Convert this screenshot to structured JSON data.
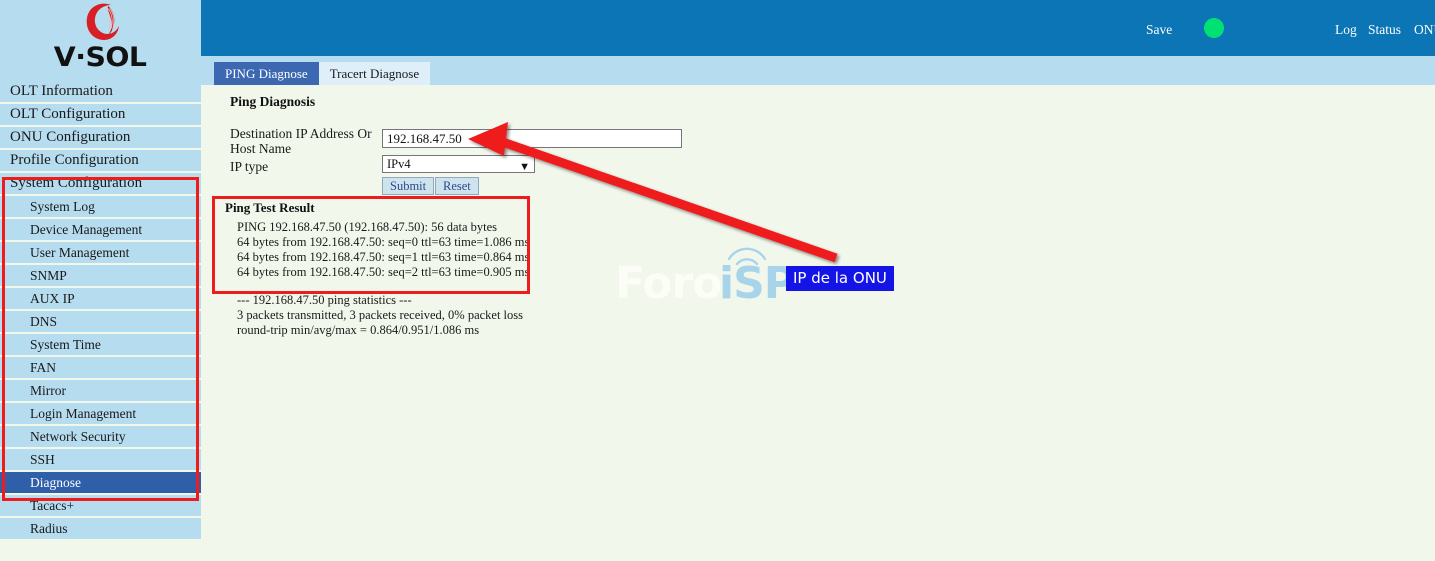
{
  "brand": {
    "logo_text": "V·SOL",
    "logo_icon": "vsol-crescent-logo"
  },
  "header": {
    "save_label": "Save",
    "status_dot": "status-indicator-green",
    "status_dot_color": "#00e173",
    "log_label": "Log",
    "status_label": "Status",
    "onu_label": "ONU",
    "background_color": "#0b75b5"
  },
  "sidebar": {
    "items": [
      {
        "label": "OLT Information",
        "level": "top",
        "selected": false
      },
      {
        "label": "OLT Configuration",
        "level": "top",
        "selected": false
      },
      {
        "label": "ONU Configuration",
        "level": "top",
        "selected": false
      },
      {
        "label": "Profile Configuration",
        "level": "top",
        "selected": false
      },
      {
        "label": "System Configuration",
        "level": "top",
        "selected": false
      },
      {
        "label": "System Log",
        "level": "sub",
        "selected": false
      },
      {
        "label": "Device Management",
        "level": "sub",
        "selected": false
      },
      {
        "label": "User Management",
        "level": "sub",
        "selected": false
      },
      {
        "label": "SNMP",
        "level": "sub",
        "selected": false
      },
      {
        "label": "AUX IP",
        "level": "sub",
        "selected": false
      },
      {
        "label": "DNS",
        "level": "sub",
        "selected": false
      },
      {
        "label": "System Time",
        "level": "sub",
        "selected": false
      },
      {
        "label": "FAN",
        "level": "sub",
        "selected": false
      },
      {
        "label": "Mirror",
        "level": "sub",
        "selected": false
      },
      {
        "label": "Login Management",
        "level": "sub",
        "selected": false
      },
      {
        "label": "Network Security",
        "level": "sub",
        "selected": false
      },
      {
        "label": "SSH",
        "level": "sub",
        "selected": false
      },
      {
        "label": "Diagnose",
        "level": "sub",
        "selected": true
      },
      {
        "label": "Tacacs+",
        "level": "sub",
        "selected": false
      },
      {
        "label": "Radius",
        "level": "sub",
        "selected": false
      }
    ]
  },
  "tabs": [
    {
      "label": "PING Diagnose",
      "active": true
    },
    {
      "label": "Tracert Diagnose",
      "active": false
    }
  ],
  "main": {
    "section_title": "Ping Diagnosis",
    "dest_label": "Destination IP Address Or Host Name",
    "dest_value": "192.168.47.50",
    "iptype_label": "IP type",
    "iptype_value": "IPv4",
    "iptype_caret": "chevron-down-icon",
    "submit_label": "Submit",
    "reset_label": "Reset"
  },
  "result": {
    "title": "Ping Test Result",
    "lines": [
      "PING 192.168.47.50 (192.168.47.50): 56 data bytes",
      "64 bytes from 192.168.47.50: seq=0 ttl=63 time=1.086 ms",
      "64 bytes from 192.168.47.50: seq=1 ttl=63 time=0.864 ms",
      "64 bytes from 192.168.47.50: seq=2 ttl=63 time=0.905 ms"
    ],
    "stats": [
      "--- 192.168.47.50 ping statistics ---",
      "3 packets transmitted, 3 packets received, 0% packet loss",
      "round-trip min/avg/max = 0.864/0.951/1.086 ms"
    ]
  },
  "annotations": {
    "label_text": "IP de la ONU",
    "label_color": "#1414e6",
    "highlight_color": "#ee1c1c",
    "arrow_icon": "red-arrow-pointing-left"
  },
  "watermark": {
    "text_light": "Foro",
    "text_accent": "iSP",
    "wifi_icon": "wifi-signal-icon",
    "accent_color": "#a8d4ea"
  }
}
